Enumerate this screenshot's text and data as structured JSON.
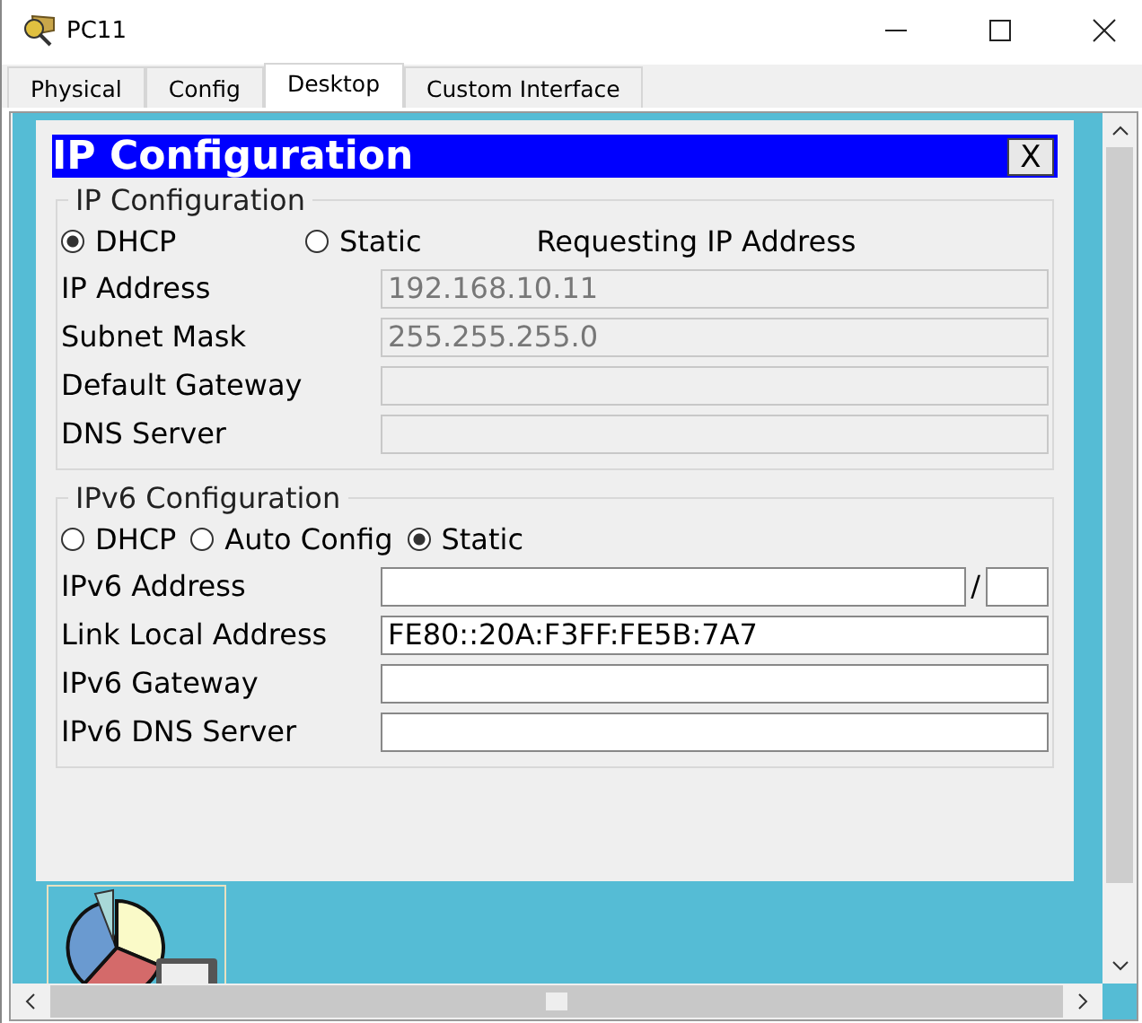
{
  "window": {
    "title": "PC11"
  },
  "tabs": [
    {
      "label": "Physical",
      "selected": false
    },
    {
      "label": "Config",
      "selected": false
    },
    {
      "label": "Desktop",
      "selected": true
    },
    {
      "label": "Custom Interface",
      "selected": false
    }
  ],
  "dialog": {
    "title": "IP Configuration",
    "close": "X",
    "ipv4": {
      "legend": "IP Configuration",
      "status": "Requesting IP Address",
      "modes": [
        {
          "label": "DHCP",
          "selected": true
        },
        {
          "label": "Static",
          "selected": false
        }
      ],
      "fields": [
        {
          "label": "IP Address",
          "value": "192.168.10.11",
          "disabled": true,
          "kind": "text"
        },
        {
          "label": "Subnet Mask",
          "value": "255.255.255.0",
          "disabled": true,
          "kind": "text"
        },
        {
          "label": "Default Gateway",
          "disabled": true,
          "kind": "text"
        },
        {
          "label": "DNS Server",
          "disabled": true,
          "kind": "text"
        }
      ]
    },
    "ipv6": {
      "legend": "IPv6 Configuration",
      "modes": [
        {
          "label": "DHCP",
          "selected": false
        },
        {
          "label": "Auto Config",
          "selected": false
        },
        {
          "label": "Static",
          "selected": true
        }
      ],
      "fields": [
        {
          "label": "IPv6 Address",
          "separator": "/",
          "disabled": false,
          "kind": "prefix"
        },
        {
          "label": "Link Local Address",
          "value": "FE80::20A:F3FF:FE5B:7A7",
          "disabled": false,
          "kind": "text"
        },
        {
          "label": "IPv6 Gateway",
          "disabled": false,
          "kind": "text"
        },
        {
          "label": "IPv6 DNS Server",
          "disabled": false,
          "kind": "text"
        }
      ]
    }
  }
}
